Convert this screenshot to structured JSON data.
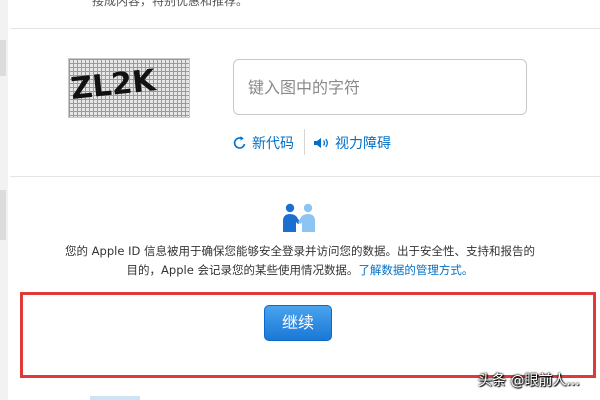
{
  "top_text": "接成内容，特别优惠和推荐。",
  "captcha": {
    "image_text": "ZL2K",
    "input_placeholder": "键入图中的字符",
    "new_code_label": "新代码",
    "vision_impaired_label": "视力障碍",
    "icons": {
      "refresh": "refresh-icon",
      "audio": "speaker-icon"
    }
  },
  "privacy": {
    "icon": "people-handshake-icon",
    "text": "您的 Apple ID 信息被用于确保您能够安全登录并访问您的数据。出于安全性、支持和报告的目的，Apple 会记录您的某些使用情况数据。",
    "link_text": "了解数据的管理方式。"
  },
  "continue_label": "继续",
  "watermark": "头条 @眼前人...",
  "colors": {
    "accent": "#0070c9",
    "highlight": "#e0393a",
    "button": "#1a78d6"
  }
}
